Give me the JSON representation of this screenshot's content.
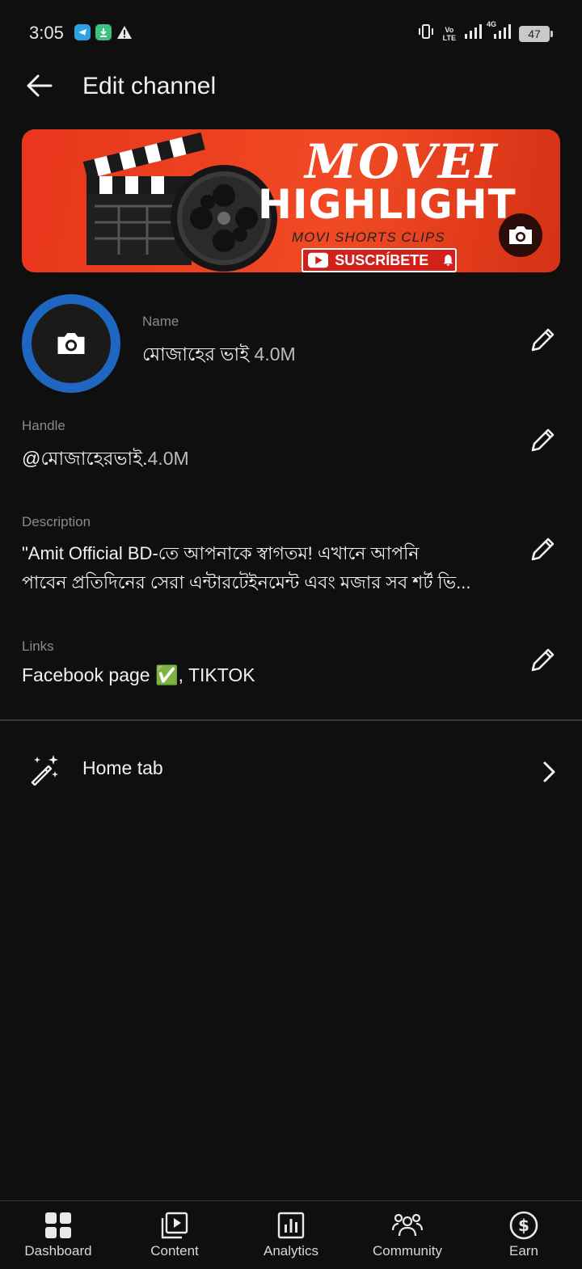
{
  "status_bar": {
    "time": "3:05",
    "net_label_top": "Vo",
    "net_label_bottom": "LTE",
    "net_4g": "4G",
    "battery": "47"
  },
  "header": {
    "title": "Edit channel"
  },
  "banner": {
    "brand_line1": "MOVEI",
    "brand_line2": "HIGHLIGHT",
    "subtitle": "MOVI SHORTS CLIPS",
    "subscribe_text": "SUSCRÍBETE"
  },
  "fields": {
    "name_label": "Name",
    "name_value": "মোজাহের ভাই",
    "name_suffix": " 4.0M",
    "handle_label": "Handle",
    "handle_value": "@মোজাহেরভাই.",
    "handle_suffix": "4.0M",
    "description_label": "Description",
    "description_line1": " \"Amit Official BD-তে আপনাকে স্বাগতম! এখানে আপনি",
    "description_line2": "পাবেন প্রতিদিনের সেরা এন্টারটেইনমেন্ট এবং মজার সব শর্ট ভি...",
    "links_label": "Links",
    "links_value": "Facebook  page ✅, TIKTOK"
  },
  "home_tab": {
    "label": "Home tab"
  },
  "bottom_nav": {
    "items": [
      {
        "label": "Dashboard",
        "icon": "dashboard-icon"
      },
      {
        "label": "Content",
        "icon": "content-icon"
      },
      {
        "label": "Analytics",
        "icon": "analytics-icon"
      },
      {
        "label": "Community",
        "icon": "community-icon"
      },
      {
        "label": "Earn",
        "icon": "earn-icon"
      }
    ]
  },
  "colors": {
    "background": "#0f0f0f",
    "avatar_ring": "#1f66c2",
    "banner_red": "#e8361c"
  }
}
